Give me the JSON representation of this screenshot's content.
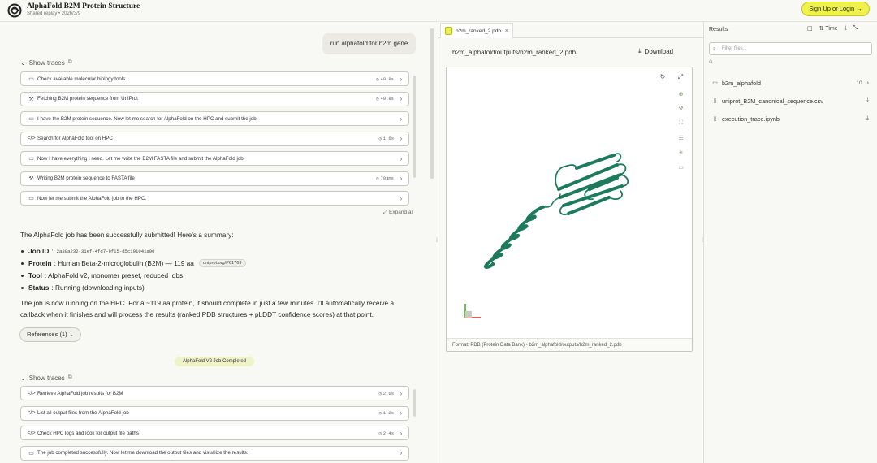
{
  "header": {
    "title": "AlphaFold B2M Protein Structure",
    "subtitle": "Shared replay • 2026/3/9",
    "signup_label": "Sign Up or Login",
    "signup_arrow": "→"
  },
  "chat": {
    "user_message": "run alphafold for b2m gene",
    "show_traces_label": "Show traces",
    "expand_all_label": "Expand all",
    "traces_group_1": [
      {
        "icon": "chat-icon",
        "glyph": "▭",
        "label": "Check available molecular biology tools",
        "duration": "49.8s",
        "has_timer": true
      },
      {
        "icon": "wrench-icon",
        "glyph": "⚒",
        "label": "Fetching B2M protein sequence from UniProt",
        "duration": "49.8s",
        "has_timer": true
      },
      {
        "icon": "chat-icon",
        "glyph": "▭",
        "label": "I have the B2M protein sequence. Now let me search for AlphaFold on the HPC and submit the job.",
        "duration": "",
        "has_timer": false
      },
      {
        "icon": "code-icon",
        "glyph": "</>",
        "label": "Search for AlphaFold tool on HPC",
        "duration": "1.6s",
        "has_timer": true
      },
      {
        "icon": "chat-icon",
        "glyph": "▭",
        "label": "Now I have everything I need. Let me write the B2M FASTA file and submit the AlphaFold job.",
        "duration": "",
        "has_timer": false
      },
      {
        "icon": "wrench-icon",
        "glyph": "⚒",
        "label": "Writing B2M protein sequence to FASTA file",
        "duration": "703ms",
        "has_timer": true
      },
      {
        "icon": "chat-icon",
        "glyph": "▭",
        "label": "Now let me submit the AlphaFold job to the HPC.",
        "duration": "",
        "has_timer": false
      }
    ],
    "summary_intro": "The AlphaFold job has been successfully submitted! Here's a summary:",
    "job_id_label": "Job ID",
    "job_id_value": "2a80a232-31ef-4fd7-9f15-d5c191041a90",
    "protein_label": "Protein",
    "protein_value": ": Human Beta-2-microglobulin (B2M) — 119 aa",
    "protein_link": "uniprot.org/P61769",
    "tool_label": "Tool",
    "tool_value": ": AlphaFold v2, monomer preset, reduced_dbs",
    "status_label": "Status",
    "status_value": ": Running (downloading inputs)",
    "paragraph_line1": "The job is now running on the HPC. For a ~119 aa protein, it should complete in just a few minutes. I'll automatically receive a",
    "paragraph_line2": "callback when it finishes and will process the results (ranked PDB structures + pLDDT confidence scores) at that point.",
    "references_label": "References",
    "references_count": "(1)",
    "event_badge": "AlphaFold V2 Job Completed",
    "traces_group_2": [
      {
        "icon": "code-icon",
        "glyph": "</>",
        "label": "Retrieve AlphaFold job results for B2M",
        "duration": "2.6s",
        "has_timer": true
      },
      {
        "icon": "code-icon",
        "glyph": "</>",
        "label": "List all output files from the AlphaFold job",
        "duration": "1.2s",
        "has_timer": true
      },
      {
        "icon": "code-icon",
        "glyph": "</>",
        "label": "Check HPC logs and look for output file paths",
        "duration": "2.4s",
        "has_timer": true
      },
      {
        "icon": "chat-icon",
        "glyph": "▭",
        "label": "The job completed successfully. Now let me download the output files and visualize the results.",
        "duration": "",
        "has_timer": false
      }
    ]
  },
  "viewer": {
    "tab_label": "b2m_ranked_2.pdb",
    "tab_close": "×",
    "file_path": "b2m_alphafold/outputs/b2m_ranked_2.pdb",
    "download_label": "Download",
    "footer_format": "Format: PDB (Protein Data Bank)",
    "footer_path": "• b2m_alphafold/outputs/b2m_ranked_2.pdb",
    "structure_color": "#1d7a5c"
  },
  "results": {
    "title": "Results",
    "sort_label": "Time",
    "filter_placeholder": "Filter files...",
    "items": [
      {
        "icon": "folder-icon",
        "glyph": "▭",
        "name": "b2m_alphafold",
        "count": "10",
        "action": "›"
      },
      {
        "icon": "file-icon",
        "glyph": "▯",
        "name": "uniprot_B2M_canonical_sequence.csv",
        "count": "",
        "action": "⤓"
      },
      {
        "icon": "file-icon",
        "glyph": "▯",
        "name": "execution_trace.ipynb",
        "count": "",
        "action": "⤓"
      }
    ]
  },
  "colors": {
    "accent": "#eef24a",
    "background": "#f8f8f4",
    "border": "#c9c9c2"
  }
}
